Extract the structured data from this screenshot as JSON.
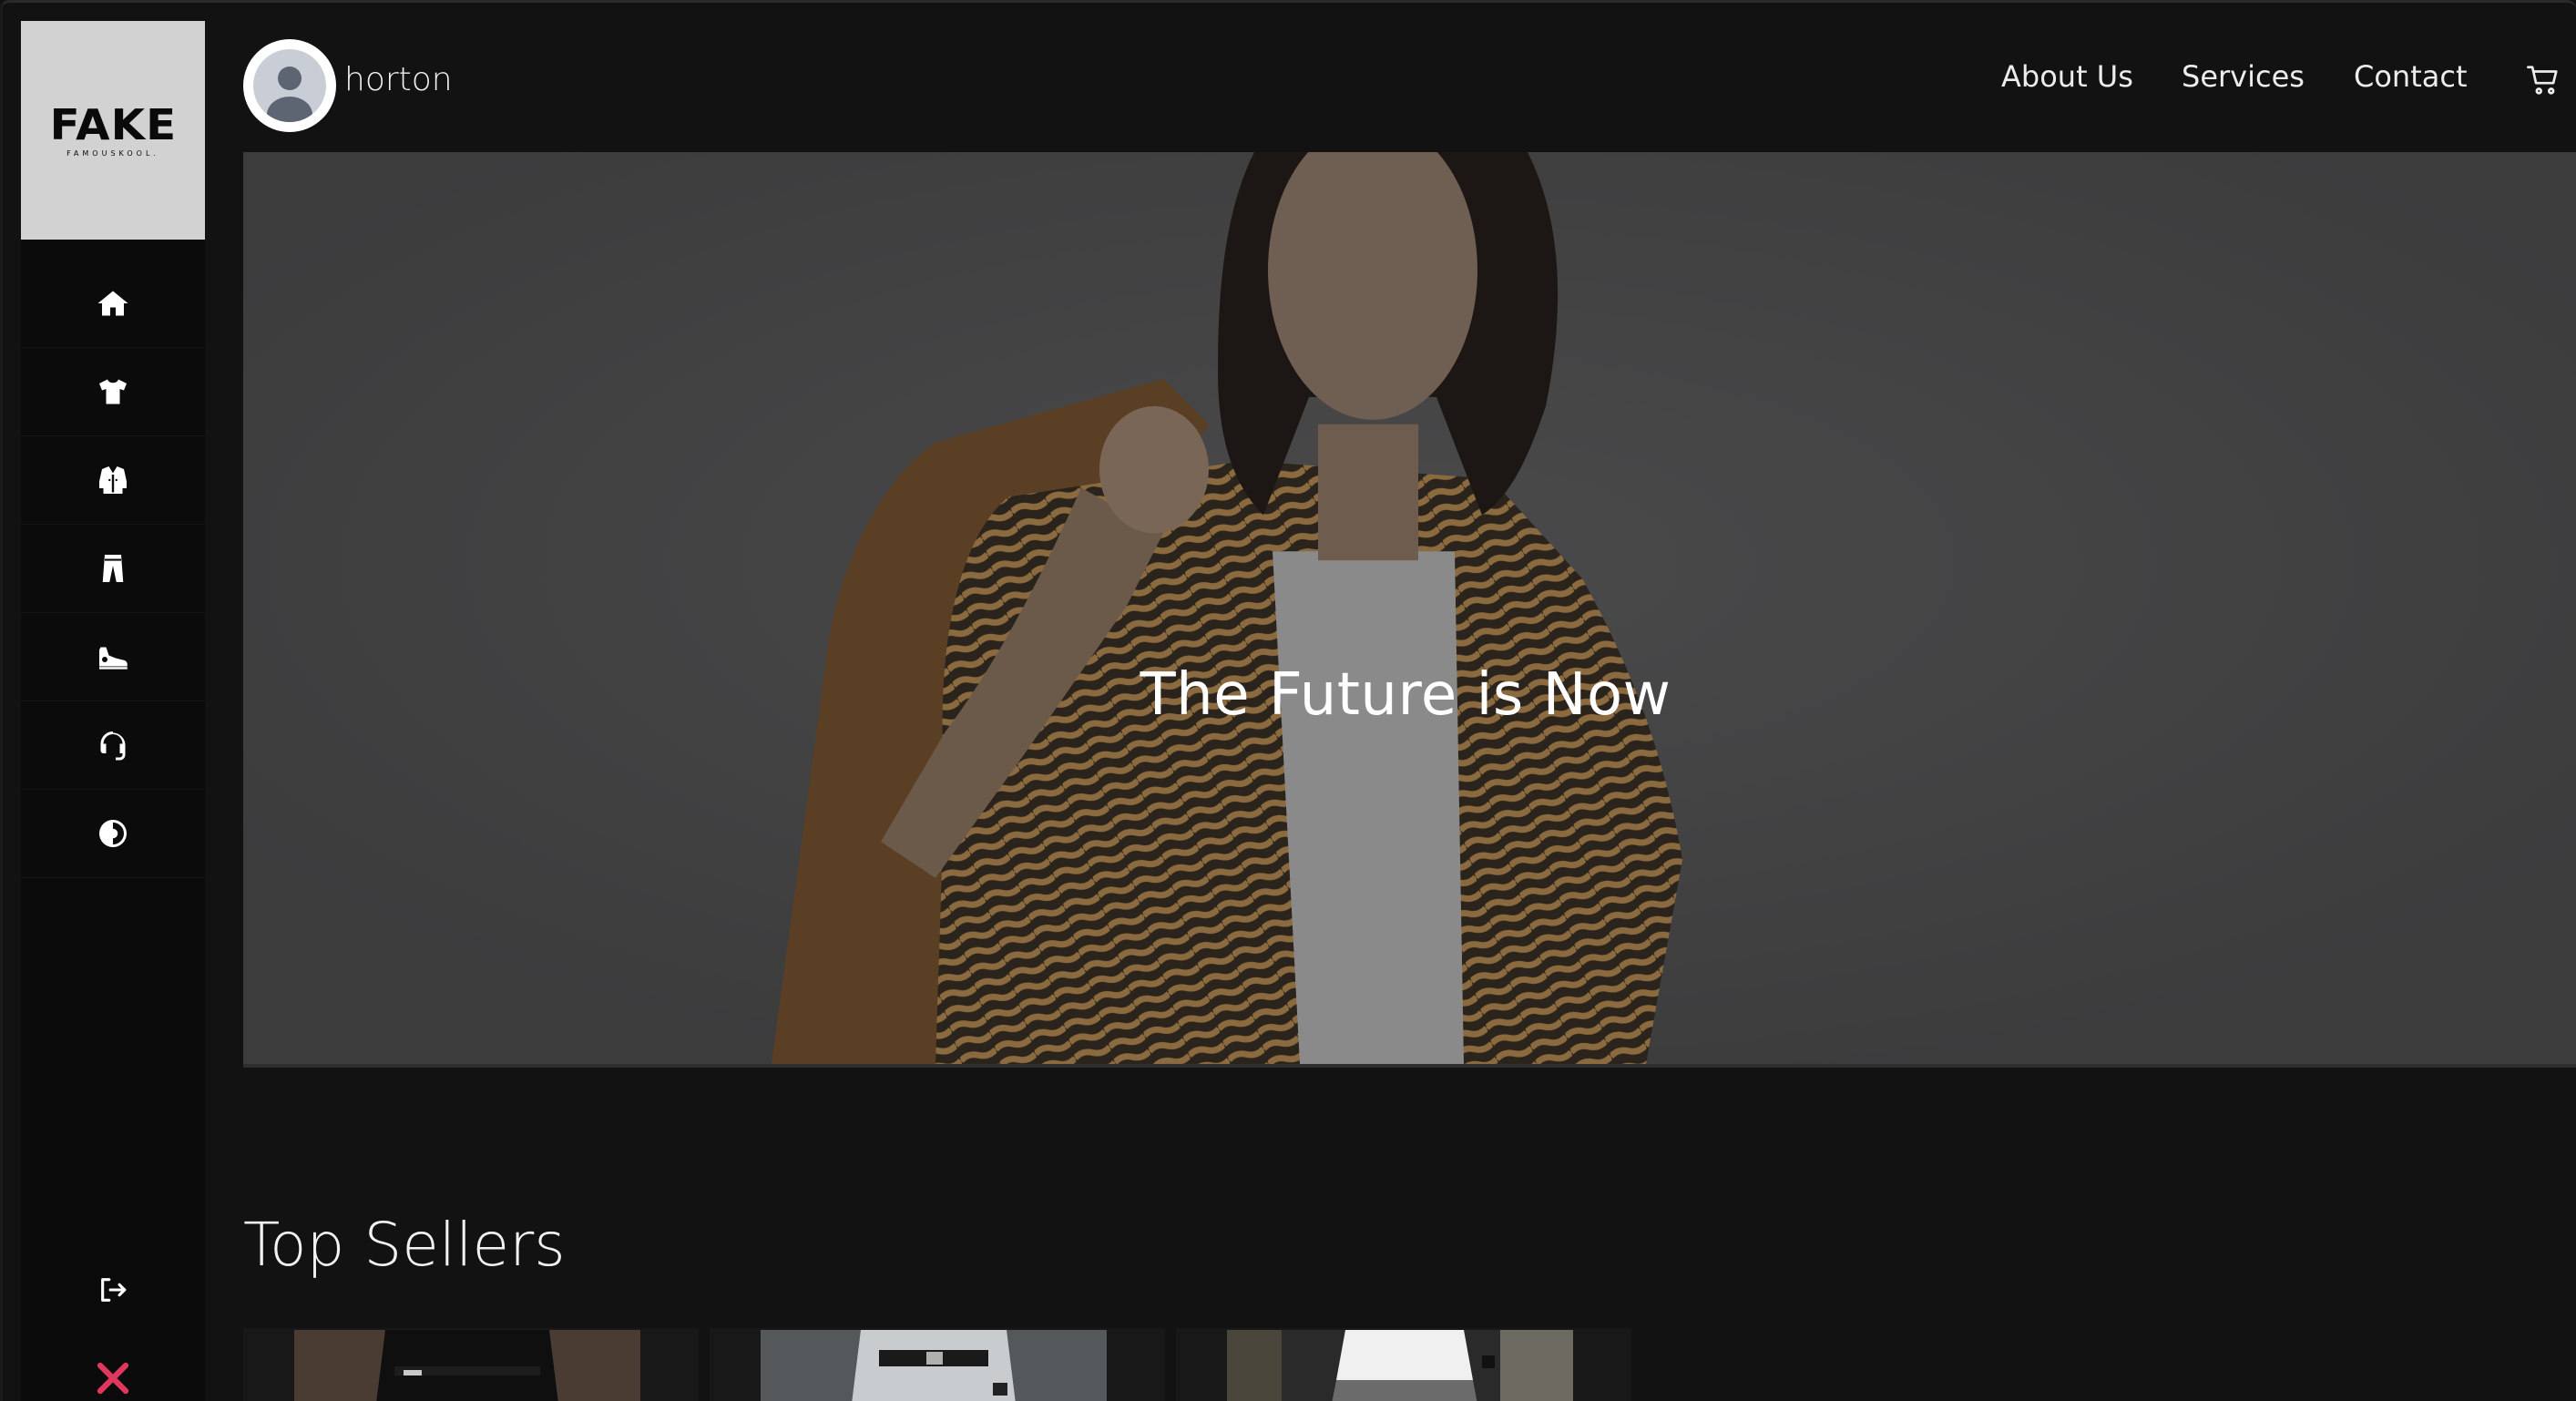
{
  "brand": {
    "logo_text": "FAKE",
    "logo_tagline": "FAMOUSKOOL."
  },
  "sidebar": {
    "items": [
      {
        "icon": "home-icon",
        "label": "Home"
      },
      {
        "icon": "tshirt-icon",
        "label": "T-Shirts"
      },
      {
        "icon": "jacket-icon",
        "label": "Jackets"
      },
      {
        "icon": "pants-icon",
        "label": "Pants"
      },
      {
        "icon": "sneaker-icon",
        "label": "Shoes"
      },
      {
        "icon": "headset-icon",
        "label": "Support"
      },
      {
        "icon": "theme-toggle-icon",
        "label": "Theme"
      }
    ],
    "logout_icon": "logout-icon",
    "close_icon": "close-icon",
    "close_color": "#e0375c"
  },
  "header": {
    "username": "horton",
    "nav": {
      "about": "About Us",
      "services": "Services",
      "contact": "Contact"
    },
    "cart_icon": "cart-icon"
  },
  "hero": {
    "title": "The Future is Now"
  },
  "top_sellers": {
    "title": "Top Sellers",
    "products": [
      {
        "image": "black-outfit-photo"
      },
      {
        "image": "white-trousers-photo"
      },
      {
        "image": "white-tee-grey-shorts-photo"
      }
    ]
  }
}
